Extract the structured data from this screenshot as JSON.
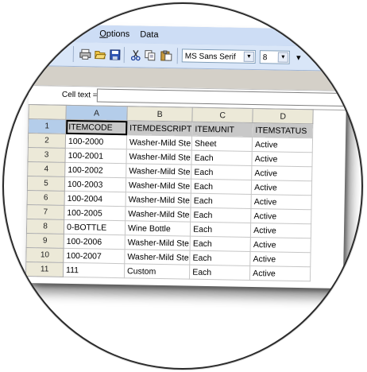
{
  "menu": {
    "options_label": "Options",
    "options_mnemonic": "O",
    "options_rest": "ptions",
    "data_label": "Data"
  },
  "toolbar": {
    "icons": [
      "print-icon",
      "open-folder-icon",
      "save-icon",
      "cut-icon",
      "copy-icon",
      "paste-icon"
    ],
    "font_name": "MS Sans Serif",
    "font_size": "8"
  },
  "cell_text": {
    "label": "Cell text =",
    "value": ""
  },
  "grid": {
    "columns": [
      "A",
      "B",
      "C",
      "D"
    ],
    "selected_column": "A",
    "rows": [
      {
        "num": "1",
        "cells": [
          "ITEMCODE",
          "ITEMDESCRIPT",
          "ITEMUNIT",
          "ITEMSTATUS"
        ]
      },
      {
        "num": "2",
        "cells": [
          "100-2000",
          "Washer-Mild Ste",
          "Sheet",
          "Active"
        ]
      },
      {
        "num": "3",
        "cells": [
          "100-2001",
          "Washer-Mild Ste",
          "Each",
          "Active"
        ]
      },
      {
        "num": "4",
        "cells": [
          "100-2002",
          "Washer-Mild Ste",
          "Each",
          "Active"
        ]
      },
      {
        "num": "5",
        "cells": [
          "100-2003",
          "Washer-Mild Ste",
          "Each",
          "Active"
        ]
      },
      {
        "num": "6",
        "cells": [
          "100-2004",
          "Washer-Mild Ste",
          "Each",
          "Active"
        ]
      },
      {
        "num": "7",
        "cells": [
          "100-2005",
          "Washer-Mild Ste",
          "Each",
          "Active"
        ]
      },
      {
        "num": "8",
        "cells": [
          "0-BOTTLE",
          "Wine Bottle",
          "Each",
          "Active"
        ]
      },
      {
        "num": "9",
        "cells": [
          "100-2006",
          "Washer-Mild Ste",
          "Each",
          "Active"
        ]
      },
      {
        "num": "10",
        "cells": [
          "100-2007",
          "Washer-Mild Ste",
          "Each",
          "Active"
        ]
      },
      {
        "num": "11",
        "cells": [
          "111",
          "Custom",
          "Each",
          "Active"
        ]
      }
    ]
  }
}
